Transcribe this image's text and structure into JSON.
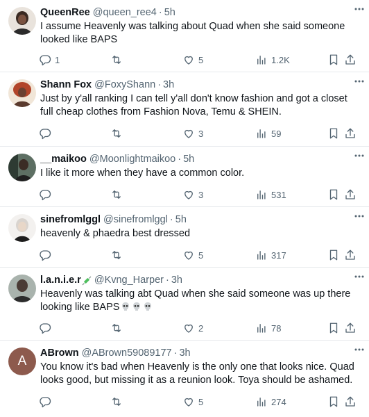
{
  "tweets": [
    {
      "name": "QueenRee",
      "handle": "@queen_ree4",
      "time": "5h",
      "text": "I assume Heavenly was talking about Quad when she said someone looked like BAPS",
      "replies": "1",
      "retweets": "",
      "likes": "5",
      "views": "1.2K",
      "avatar_color": "#3a2a22"
    },
    {
      "name": "Shann Fox",
      "handle": "@FoxyShann",
      "time": "3h",
      "text": "Just by y'all ranking I can tell y'all don't know fashion and got a closet full cheap clothes from Fashion Nova, Temu & SHEIN.",
      "replies": "",
      "retweets": "",
      "likes": "3",
      "views": "59",
      "avatar_color": "#b2452a"
    },
    {
      "name": "__maikoo",
      "handle": "@Moonlightmaikoo",
      "time": "5h",
      "text": "I like it more when they have a common color.",
      "replies": "",
      "retweets": "",
      "likes": "3",
      "views": "531",
      "avatar_color": "#2e3b33"
    },
    {
      "name": "sinefromlggl",
      "handle": "@sinefromlggl",
      "time": "5h",
      "text": "heavenly & phaedra best dressed",
      "replies": "",
      "retweets": "",
      "likes": "5",
      "views": "317",
      "avatar_color": "#d9d4cf"
    },
    {
      "name": "l.a.n.i.e.r",
      "handle": "@Kvng_Harper",
      "time": "3h",
      "text": "Heavenly was talking abt Quad when she said someone was up there looking like BAPS",
      "replies": "",
      "retweets": "",
      "likes": "2",
      "views": "78",
      "avatar_color": "#4a3b35"
    },
    {
      "name": "ABrown",
      "handle": "@ABrown59089177",
      "time": "3h",
      "text": "You know it's bad when Heavenly is the only one that looks nice. Quad looks good, but missing it as a reunion look. Toya should be ashamed.",
      "replies": "",
      "retweets": "",
      "likes": "5",
      "views": "274",
      "avatar_letter": "A",
      "avatar_color": "#8d5a4d"
    }
  ],
  "colors": {
    "text": "#0f1419",
    "secondary": "#536471",
    "divider": "#e6e9ec"
  },
  "icons": [
    "more-icon",
    "reply-icon",
    "retweet-icon",
    "like-icon",
    "views-icon",
    "bookmark-icon",
    "share-icon",
    "skull-emoji",
    "syringe-emoji"
  ]
}
